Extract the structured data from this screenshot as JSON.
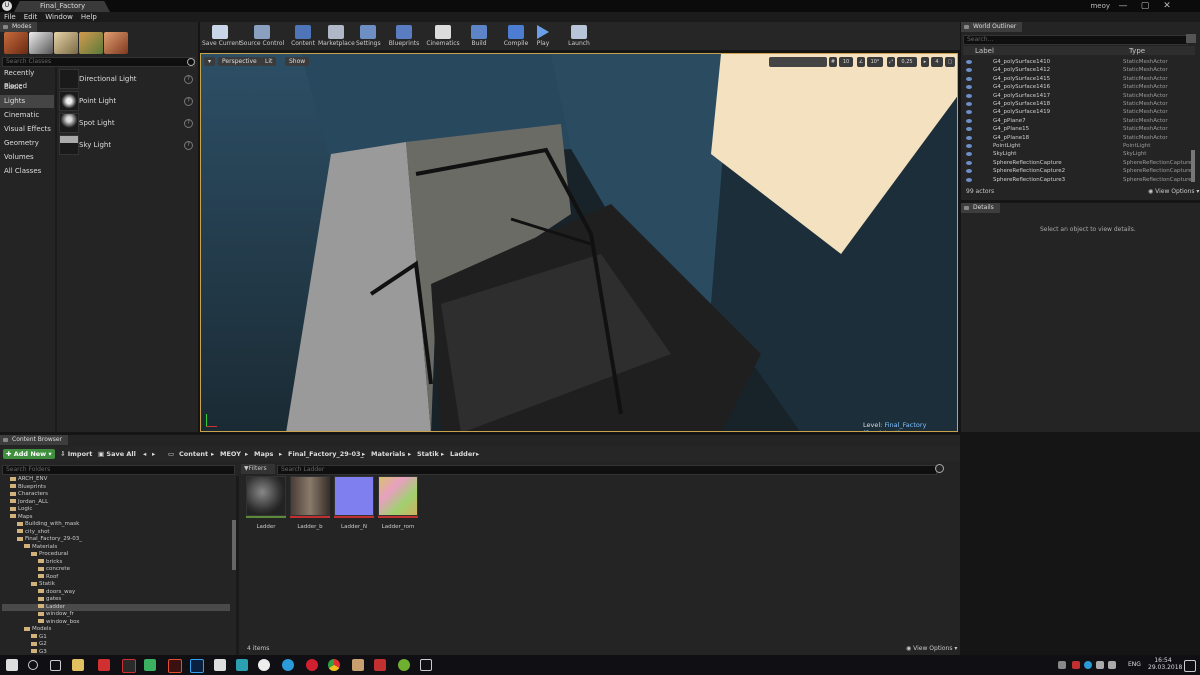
{
  "window": {
    "doc_tab": "Final_Factory",
    "user": "meoy",
    "controls": [
      "—",
      "▢",
      "✕"
    ]
  },
  "menu": [
    "File",
    "Edit",
    "Window",
    "Help"
  ],
  "modes": {
    "tab_label": "Modes",
    "search_placeholder": "Search Classes",
    "categories": [
      "Recently Placed",
      "Basic",
      "Lights",
      "Cinematic",
      "Visual Effects",
      "Geometry",
      "Volumes",
      "All Classes"
    ],
    "active_category": "Lights",
    "lights": [
      "Directional Light",
      "Point Light",
      "Spot Light",
      "Sky Light"
    ]
  },
  "toolbar": {
    "buttons": [
      "Save Current",
      "Source Control",
      "Content",
      "Marketplace",
      "Settings",
      "Blueprints",
      "Cinematics",
      "Build",
      "Compile",
      "Play",
      "Launch"
    ]
  },
  "viewport": {
    "perspective": "Perspective",
    "lit": "Lit",
    "show": "Show",
    "grid_snap": "10",
    "rot_snap": "10°",
    "scale_snap": "0,25",
    "cam_speed": "4",
    "level_label": "Level:",
    "level_name": "Final_Factory (Persistent)"
  },
  "outliner": {
    "tab_label": "World Outliner",
    "search_placeholder": "Search...",
    "col_label": "Label",
    "col_type": "Type",
    "rows": [
      {
        "name": "G4_polySurface1410",
        "type": "StaticMeshActor"
      },
      {
        "name": "G4_polySurface1412",
        "type": "StaticMeshActor"
      },
      {
        "name": "G4_polySurface1415",
        "type": "StaticMeshActor"
      },
      {
        "name": "G4_polySurface1416",
        "type": "StaticMeshActor"
      },
      {
        "name": "G4_polySurface1417",
        "type": "StaticMeshActor"
      },
      {
        "name": "G4_polySurface1418",
        "type": "StaticMeshActor"
      },
      {
        "name": "G4_polySurface1419",
        "type": "StaticMeshActor"
      },
      {
        "name": "G4_pPlane7",
        "type": "StaticMeshActor"
      },
      {
        "name": "G4_pPlane15",
        "type": "StaticMeshActor"
      },
      {
        "name": "G4_pPlane18",
        "type": "StaticMeshActor"
      },
      {
        "name": "PointLight",
        "type": "PointLight"
      },
      {
        "name": "SkyLight",
        "type": "SkyLight"
      },
      {
        "name": "SphereReflectionCapture",
        "type": "SphereReflectionCapture"
      },
      {
        "name": "SphereReflectionCapture2",
        "type": "SphereReflectionCapture"
      },
      {
        "name": "SphereReflectionCapture3",
        "type": "SphereReflectionCapture"
      }
    ],
    "actor_count": "99 actors",
    "view_options": "View Options"
  },
  "details": {
    "tab_label": "Details",
    "empty_text": "Select an object to view details."
  },
  "content_browser": {
    "tab_label": "Content Browser",
    "add_new": "Add New",
    "import": "Import",
    "save_all": "Save All",
    "breadcrumbs": [
      "Content",
      "MEOY",
      "Maps",
      "Final_Factory_29-03_",
      "Materials",
      "Statik",
      "Ladder"
    ],
    "search_folders": "Search Folders",
    "filters": "Filters",
    "search_assets": "Search Ladder",
    "tree": [
      {
        "label": "ARCH_ENV",
        "depth": 1
      },
      {
        "label": "Blueprints",
        "depth": 1
      },
      {
        "label": "Characters",
        "depth": 1
      },
      {
        "label": "Jordan_ALL",
        "depth": 1
      },
      {
        "label": "Logic",
        "depth": 1
      },
      {
        "label": "Maps",
        "depth": 1
      },
      {
        "label": "Building_with_mask",
        "depth": 2
      },
      {
        "label": "city_shot",
        "depth": 2
      },
      {
        "label": "Final_Factory_29-03_",
        "depth": 2
      },
      {
        "label": "Materials",
        "depth": 3
      },
      {
        "label": "Procedural",
        "depth": 4
      },
      {
        "label": "bricks",
        "depth": 5
      },
      {
        "label": "concrete",
        "depth": 5
      },
      {
        "label": "Roof",
        "depth": 5
      },
      {
        "label": "Statik",
        "depth": 4
      },
      {
        "label": "doors_way",
        "depth": 5
      },
      {
        "label": "gates",
        "depth": 5
      },
      {
        "label": "Ladder",
        "depth": 5
      },
      {
        "label": "window_fr",
        "depth": 5
      },
      {
        "label": "window_box",
        "depth": 5
      },
      {
        "label": "Models",
        "depth": 3
      },
      {
        "label": "G1",
        "depth": 4
      },
      {
        "label": "G2",
        "depth": 4
      },
      {
        "label": "G3",
        "depth": 4
      }
    ],
    "selected_folder": "Ladder",
    "assets": [
      {
        "name": "Ladder",
        "color": "#555555"
      },
      {
        "name": "Ladder_b",
        "color": "#6b5a50"
      },
      {
        "name": "Ladder_N",
        "color": "#7f7ff0"
      },
      {
        "name": "Ladder_rom",
        "color": "#c8b86a"
      }
    ],
    "item_count": "4 items",
    "view_options": "View Options"
  },
  "taskbar": {
    "lang": "ENG",
    "time": "16:54",
    "date": "29.03.2018"
  }
}
